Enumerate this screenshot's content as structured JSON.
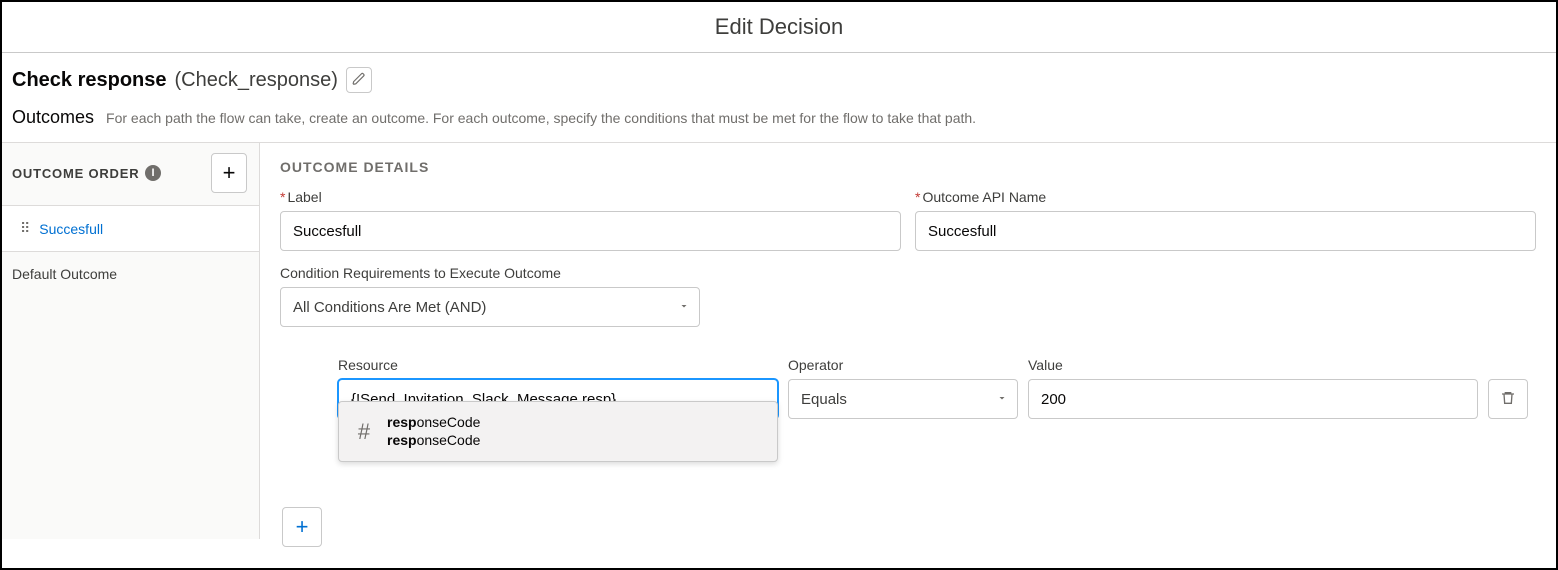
{
  "title": "Edit Decision",
  "decision": {
    "label": "Check response",
    "api_name": "(Check_response)"
  },
  "outcomes_section": {
    "heading": "Outcomes",
    "help": "For each path the flow can take, create an outcome. For each outcome, specify the conditions that must be met for the flow to take that path."
  },
  "sidebar": {
    "heading": "OUTCOME ORDER",
    "items": [
      {
        "label": "Succesfull"
      }
    ],
    "default_label": "Default Outcome"
  },
  "details": {
    "heading": "OUTCOME DETAILS",
    "label_field": {
      "label": "Label",
      "value": "Succesfull"
    },
    "api_name_field": {
      "label": "Outcome API Name",
      "value": "Succesfull"
    },
    "condition_requirements": {
      "label": "Condition Requirements to Execute Outcome",
      "value": "All Conditions Are Met (AND)"
    },
    "condition": {
      "resource_label": "Resource",
      "resource_value": "{!Send_Invitation_Slack_Message.resp}",
      "operator_label": "Operator",
      "operator_value": "Equals",
      "value_label": "Value",
      "value_value": "200"
    },
    "typeahead": {
      "bold1": "resp",
      "rest1": "onseCode",
      "bold2": "resp",
      "rest2": "onseCode"
    }
  }
}
